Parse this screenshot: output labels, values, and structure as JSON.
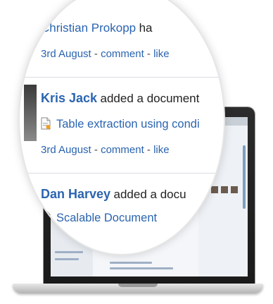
{
  "feed": {
    "item1": {
      "actor": "Christian Prokopp",
      "action": "ha",
      "date": "3rd August",
      "comment": "comment",
      "like": "like",
      "separator": " - "
    },
    "item2": {
      "actor": "Kris Jack",
      "action": "added a document",
      "document": "Table extraction using condi",
      "date": "3rd August",
      "comment": "comment",
      "like": "like",
      "separator": " - "
    },
    "item3": {
      "actor": "Dan Harvey",
      "action": "added a docu",
      "document": "Scalable Document"
    }
  },
  "colors": {
    "link": "#2a64b0",
    "text": "#222222"
  },
  "icons": {
    "document": "document-icon"
  }
}
